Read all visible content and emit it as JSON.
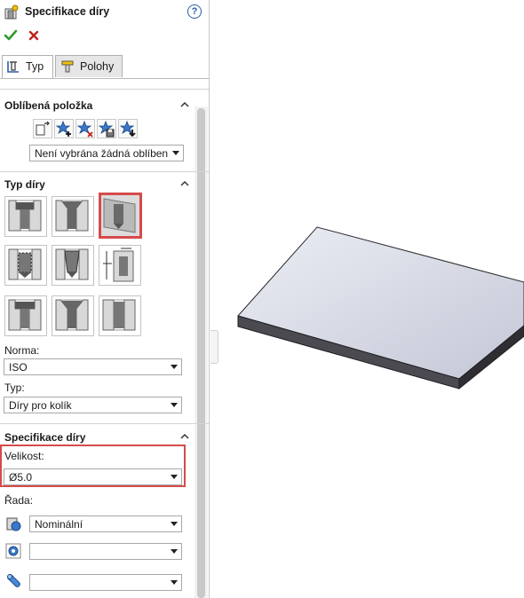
{
  "panel": {
    "title": "Specifikace díry",
    "help": "?",
    "ok_icon": "check-icon",
    "cancel_icon": "cross-icon",
    "tabs": [
      {
        "label": "Typ",
        "icon": "hole-type-icon",
        "active": true
      },
      {
        "label": "Polohy",
        "icon": "hole-position-icon",
        "active": false
      }
    ]
  },
  "favorites": {
    "title": "Oblíbená položka",
    "icons": [
      "apply-defaults-icon",
      "add-favorite-icon",
      "delete-favorite-icon",
      "save-favorite-icon",
      "load-favorite-icon"
    ],
    "select_value": "Není vybrána žádná oblíbena"
  },
  "hole_type": {
    "title": "Typ díry",
    "buttons": [
      {
        "name": "counterbore-button",
        "icon": "counterbore-icon",
        "selected": false
      },
      {
        "name": "countersink-button",
        "icon": "countersink-icon",
        "selected": false
      },
      {
        "name": "hole-button",
        "icon": "simple-hole-icon",
        "selected": true
      },
      {
        "name": "straight-tap-button",
        "icon": "straight-tap-icon",
        "selected": false
      },
      {
        "name": "tapered-tap-button",
        "icon": "tapered-tap-icon",
        "selected": false
      },
      {
        "name": "legacy-hole-button",
        "icon": "legacy-hole-icon",
        "selected": false
      },
      {
        "name": "counterbore-slot-button",
        "icon": "counterbore-slot-icon",
        "selected": false
      },
      {
        "name": "countersink-slot-button",
        "icon": "countersink-slot-icon",
        "selected": false
      },
      {
        "name": "slot-button",
        "icon": "slot-icon",
        "selected": false
      }
    ],
    "standard_label": "Norma:",
    "standard_value": "ISO",
    "type_label": "Typ:",
    "type_value": "Díry pro kolík"
  },
  "hole_spec": {
    "title": "Specifikace díry",
    "size_label": "Velikost:",
    "size_value": "Ø5.0",
    "fit_label": "Řada:",
    "fit_icon": "fit-icon",
    "fit_value": "Nominální",
    "field2_icon": "hole-diameter-icon",
    "field2_value": "",
    "field3_icon": "cylinder-icon",
    "field3_value": ""
  },
  "colors": {
    "highlight": "#d64b4b",
    "ok": "#2e9a2e",
    "cancel": "#c0201c",
    "plate_top": "#d9dbe6",
    "plate_side": "#3b3b3f"
  }
}
